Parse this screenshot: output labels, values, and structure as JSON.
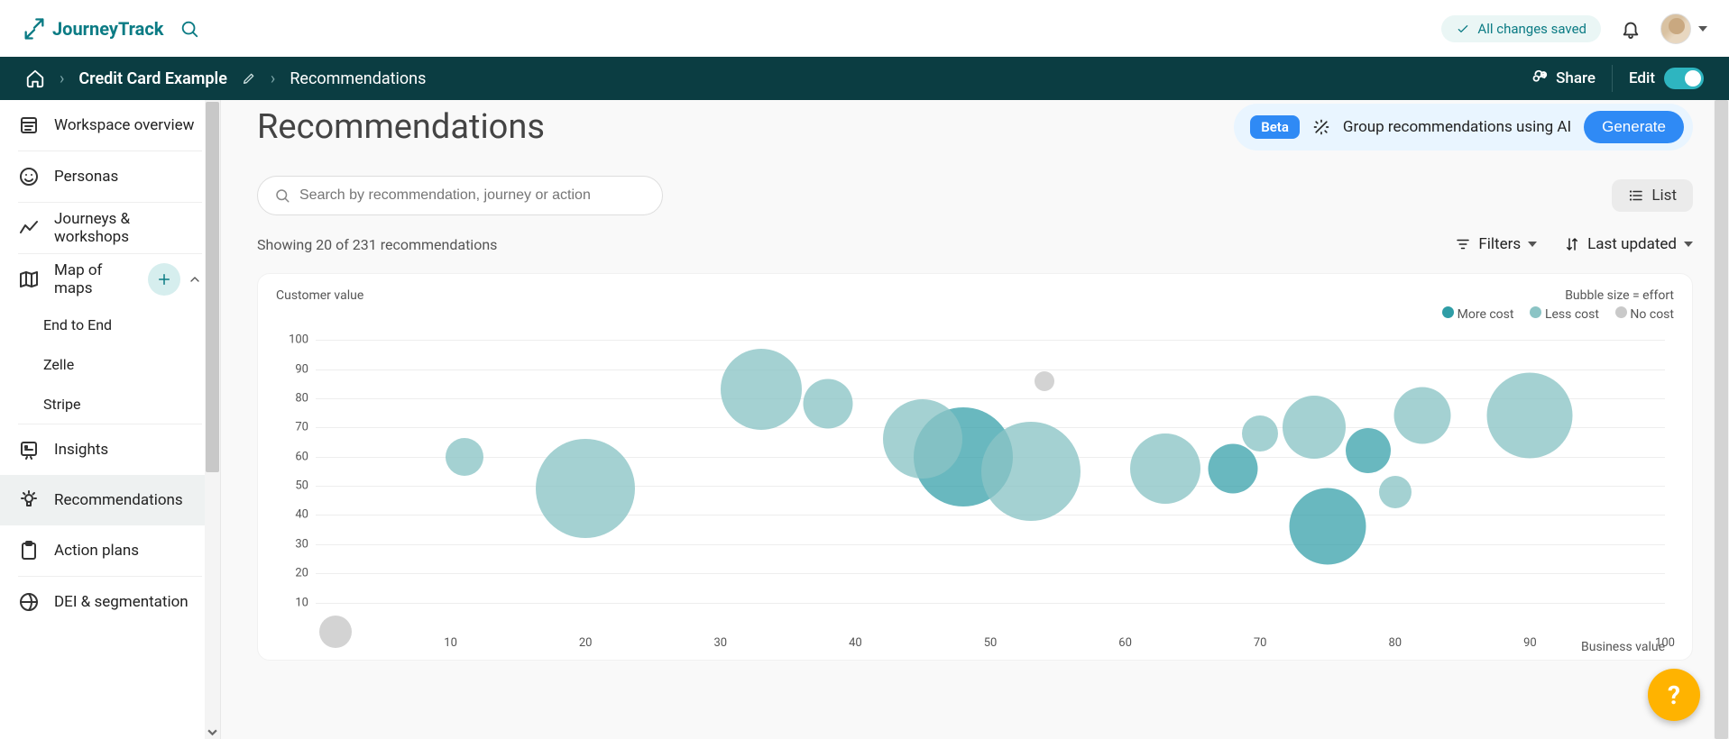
{
  "brand": {
    "name": "JourneyTrack"
  },
  "topbar": {
    "save_status": "All changes saved"
  },
  "breadcrumb": {
    "project": "Credit Card Example",
    "page": "Recommendations",
    "share_label": "Share",
    "edit_label": "Edit"
  },
  "sidebar": {
    "items": [
      {
        "label": "Workspace overview",
        "icon": "overview-icon"
      },
      {
        "label": "Personas",
        "icon": "persona-icon"
      },
      {
        "label": "Journeys & workshops",
        "icon": "journeys-icon"
      },
      {
        "label": "Map of maps",
        "icon": "map-icon",
        "expandable": true,
        "children": [
          {
            "label": "End to End"
          },
          {
            "label": "Zelle"
          },
          {
            "label": "Stripe"
          }
        ]
      },
      {
        "label": "Insights",
        "icon": "insights-icon"
      },
      {
        "label": "Recommendations",
        "icon": "recommendations-icon",
        "selected": true
      },
      {
        "label": "Action plans",
        "icon": "actionplans-icon"
      },
      {
        "label": "DEI & segmentation",
        "icon": "dei-icon"
      }
    ]
  },
  "main": {
    "title": "Recommendations",
    "beta_label": "Beta",
    "ai_group_label": "Group recommendations using AI",
    "generate_label": "Generate",
    "search_placeholder": "Search by recommendation, journey or action",
    "list_label": "List",
    "results_text": "Showing 20 of 231 recommendations",
    "filters_label": "Filters",
    "sort_label": "Last updated"
  },
  "chart_data": {
    "type": "scatter",
    "title": "",
    "xlabel": "Business value",
    "ylabel": "Customer value",
    "xlim": [
      0,
      100
    ],
    "ylim": [
      0,
      105
    ],
    "x_ticks": [
      10,
      20,
      30,
      40,
      50,
      60,
      70,
      80,
      90,
      100
    ],
    "y_ticks": [
      10,
      20,
      30,
      40,
      50,
      60,
      70,
      80,
      90,
      100
    ],
    "legend_title": "Bubble size = effort",
    "legend": [
      {
        "name": "More cost",
        "color": "#2f9da6"
      },
      {
        "name": "Less cost",
        "color": "#8bc4c5"
      },
      {
        "name": "No cost",
        "color": "#c9c9c9"
      }
    ],
    "series": [
      {
        "name": "More cost",
        "color": "rgba(47,157,166,0.72)",
        "points": [
          {
            "x": 48,
            "y": 60,
            "r": 110
          },
          {
            "x": 68,
            "y": 56,
            "r": 55
          },
          {
            "x": 75,
            "y": 36,
            "r": 85
          },
          {
            "x": 78,
            "y": 62,
            "r": 50
          }
        ]
      },
      {
        "name": "Less cost",
        "color": "rgba(139,196,197,0.78)",
        "points": [
          {
            "x": 11,
            "y": 60,
            "r": 42
          },
          {
            "x": 20,
            "y": 49,
            "r": 110
          },
          {
            "x": 33,
            "y": 83,
            "r": 90
          },
          {
            "x": 38,
            "y": 78,
            "r": 55
          },
          {
            "x": 45,
            "y": 66,
            "r": 88
          },
          {
            "x": 53,
            "y": 55,
            "r": 110
          },
          {
            "x": 63,
            "y": 56,
            "r": 78
          },
          {
            "x": 70,
            "y": 68,
            "r": 40
          },
          {
            "x": 74,
            "y": 70,
            "r": 70
          },
          {
            "x": 82,
            "y": 74,
            "r": 63
          },
          {
            "x": 80,
            "y": 48,
            "r": 36
          },
          {
            "x": 90,
            "y": 74,
            "r": 95
          }
        ]
      },
      {
        "name": "No cost",
        "color": "rgba(201,201,201,0.82)",
        "points": [
          {
            "x": 1.5,
            "y": 0,
            "r": 36
          },
          {
            "x": 54,
            "y": 86,
            "r": 22
          }
        ]
      }
    ]
  },
  "help_fab": "?"
}
